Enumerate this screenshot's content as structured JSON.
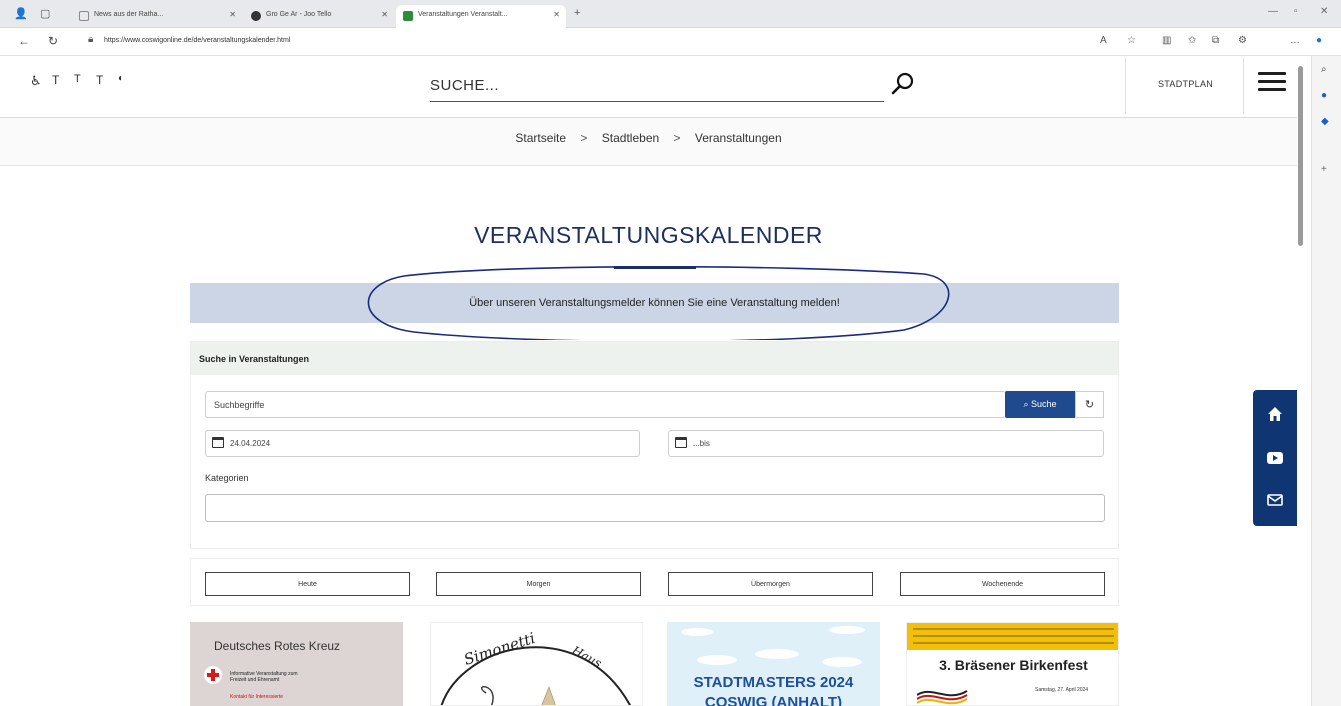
{
  "browser": {
    "tabs": [
      {
        "title": "News aus der Ratha...",
        "favicon": "page-icon"
      },
      {
        "title": "Gro Ge Ar - Joo Tello",
        "favicon": "shop-icon"
      },
      {
        "title": "Veranstaltungen Veranstalt...",
        "favicon": "shield-icon"
      }
    ],
    "url": "https://www.coswigonline.de/de/veranstaltungskalender.html"
  },
  "header": {
    "search_placeholder": "SUCHE...",
    "stadtplan_label": "STADTPLAN"
  },
  "breadcrumb": {
    "items": [
      "Startseite",
      "Stadtleben",
      "Veranstaltungen"
    ],
    "separator": ">"
  },
  "page": {
    "title": "VERANSTALTUNGSKALENDER",
    "info_text": "Über unseren Veranstaltungsmelder können Sie eine Veranstaltung melden!"
  },
  "search_panel": {
    "heading": "Suche in Veranstaltungen",
    "query_placeholder": "Suchbegriffe",
    "search_button": "Suche",
    "date_from": "24.04.2024",
    "date_to_placeholder": "...bis",
    "categories_label": "Kategorien"
  },
  "quick_filters": [
    "Heute",
    "Morgen",
    "Übermorgen",
    "Wochenende"
  ],
  "cards": [
    {
      "title": "Deutsches Rotes Kreuz",
      "line1": "Informative Veranstaltung zum",
      "line2": "Freizeit und Ehrenamt",
      "line3": "Kontakt für Interessierte"
    },
    {
      "title": "Simonetti Haus"
    },
    {
      "title": "STADTMASTERS 2024",
      "subtitle": "COSWIG (ANHALT)"
    },
    {
      "title": "3. Bräsener Birkenfest",
      "date": "Samstag, 27. April 2024"
    }
  ],
  "accent_colors": {
    "navy": "#1c2f5e",
    "button_blue": "#1f4b8e",
    "info_bg": "#cbd5e6",
    "float_bar": "#0f3572"
  }
}
